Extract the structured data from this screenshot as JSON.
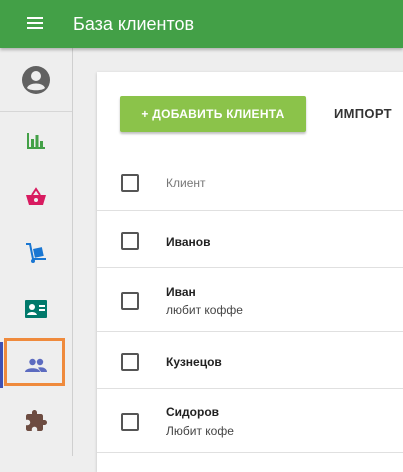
{
  "appbar": {
    "title": "База клиентов",
    "color": "#43a047"
  },
  "sidebar": {
    "profile_icon": "account-circle-icon",
    "items": [
      {
        "icon": "bar-chart-icon",
        "color": "#43a047",
        "active": false
      },
      {
        "icon": "basket-icon",
        "color": "#d81b60",
        "active": false
      },
      {
        "icon": "hand-truck-icon",
        "color": "#1976d2",
        "active": false
      },
      {
        "icon": "contact-card-icon",
        "color": "#00796b",
        "active": false
      },
      {
        "icon": "people-icon",
        "color": "#5c6bc0",
        "active": true
      },
      {
        "icon": "puzzle-icon",
        "color": "#6d4c41",
        "active": false
      }
    ]
  },
  "toolbar": {
    "add_label": "+ ДОБАВИТЬ КЛИЕНТА",
    "add_color": "#8bc34a",
    "import_label": "ИМПОРТ"
  },
  "table": {
    "column_header": "Клиент",
    "rows": [
      {
        "name": "Иванов",
        "note": ""
      },
      {
        "name": "Иван",
        "note": "любит коффе"
      },
      {
        "name": "Кузнецов",
        "note": ""
      },
      {
        "name": "Сидоров",
        "note": "Любит кофе"
      }
    ]
  }
}
